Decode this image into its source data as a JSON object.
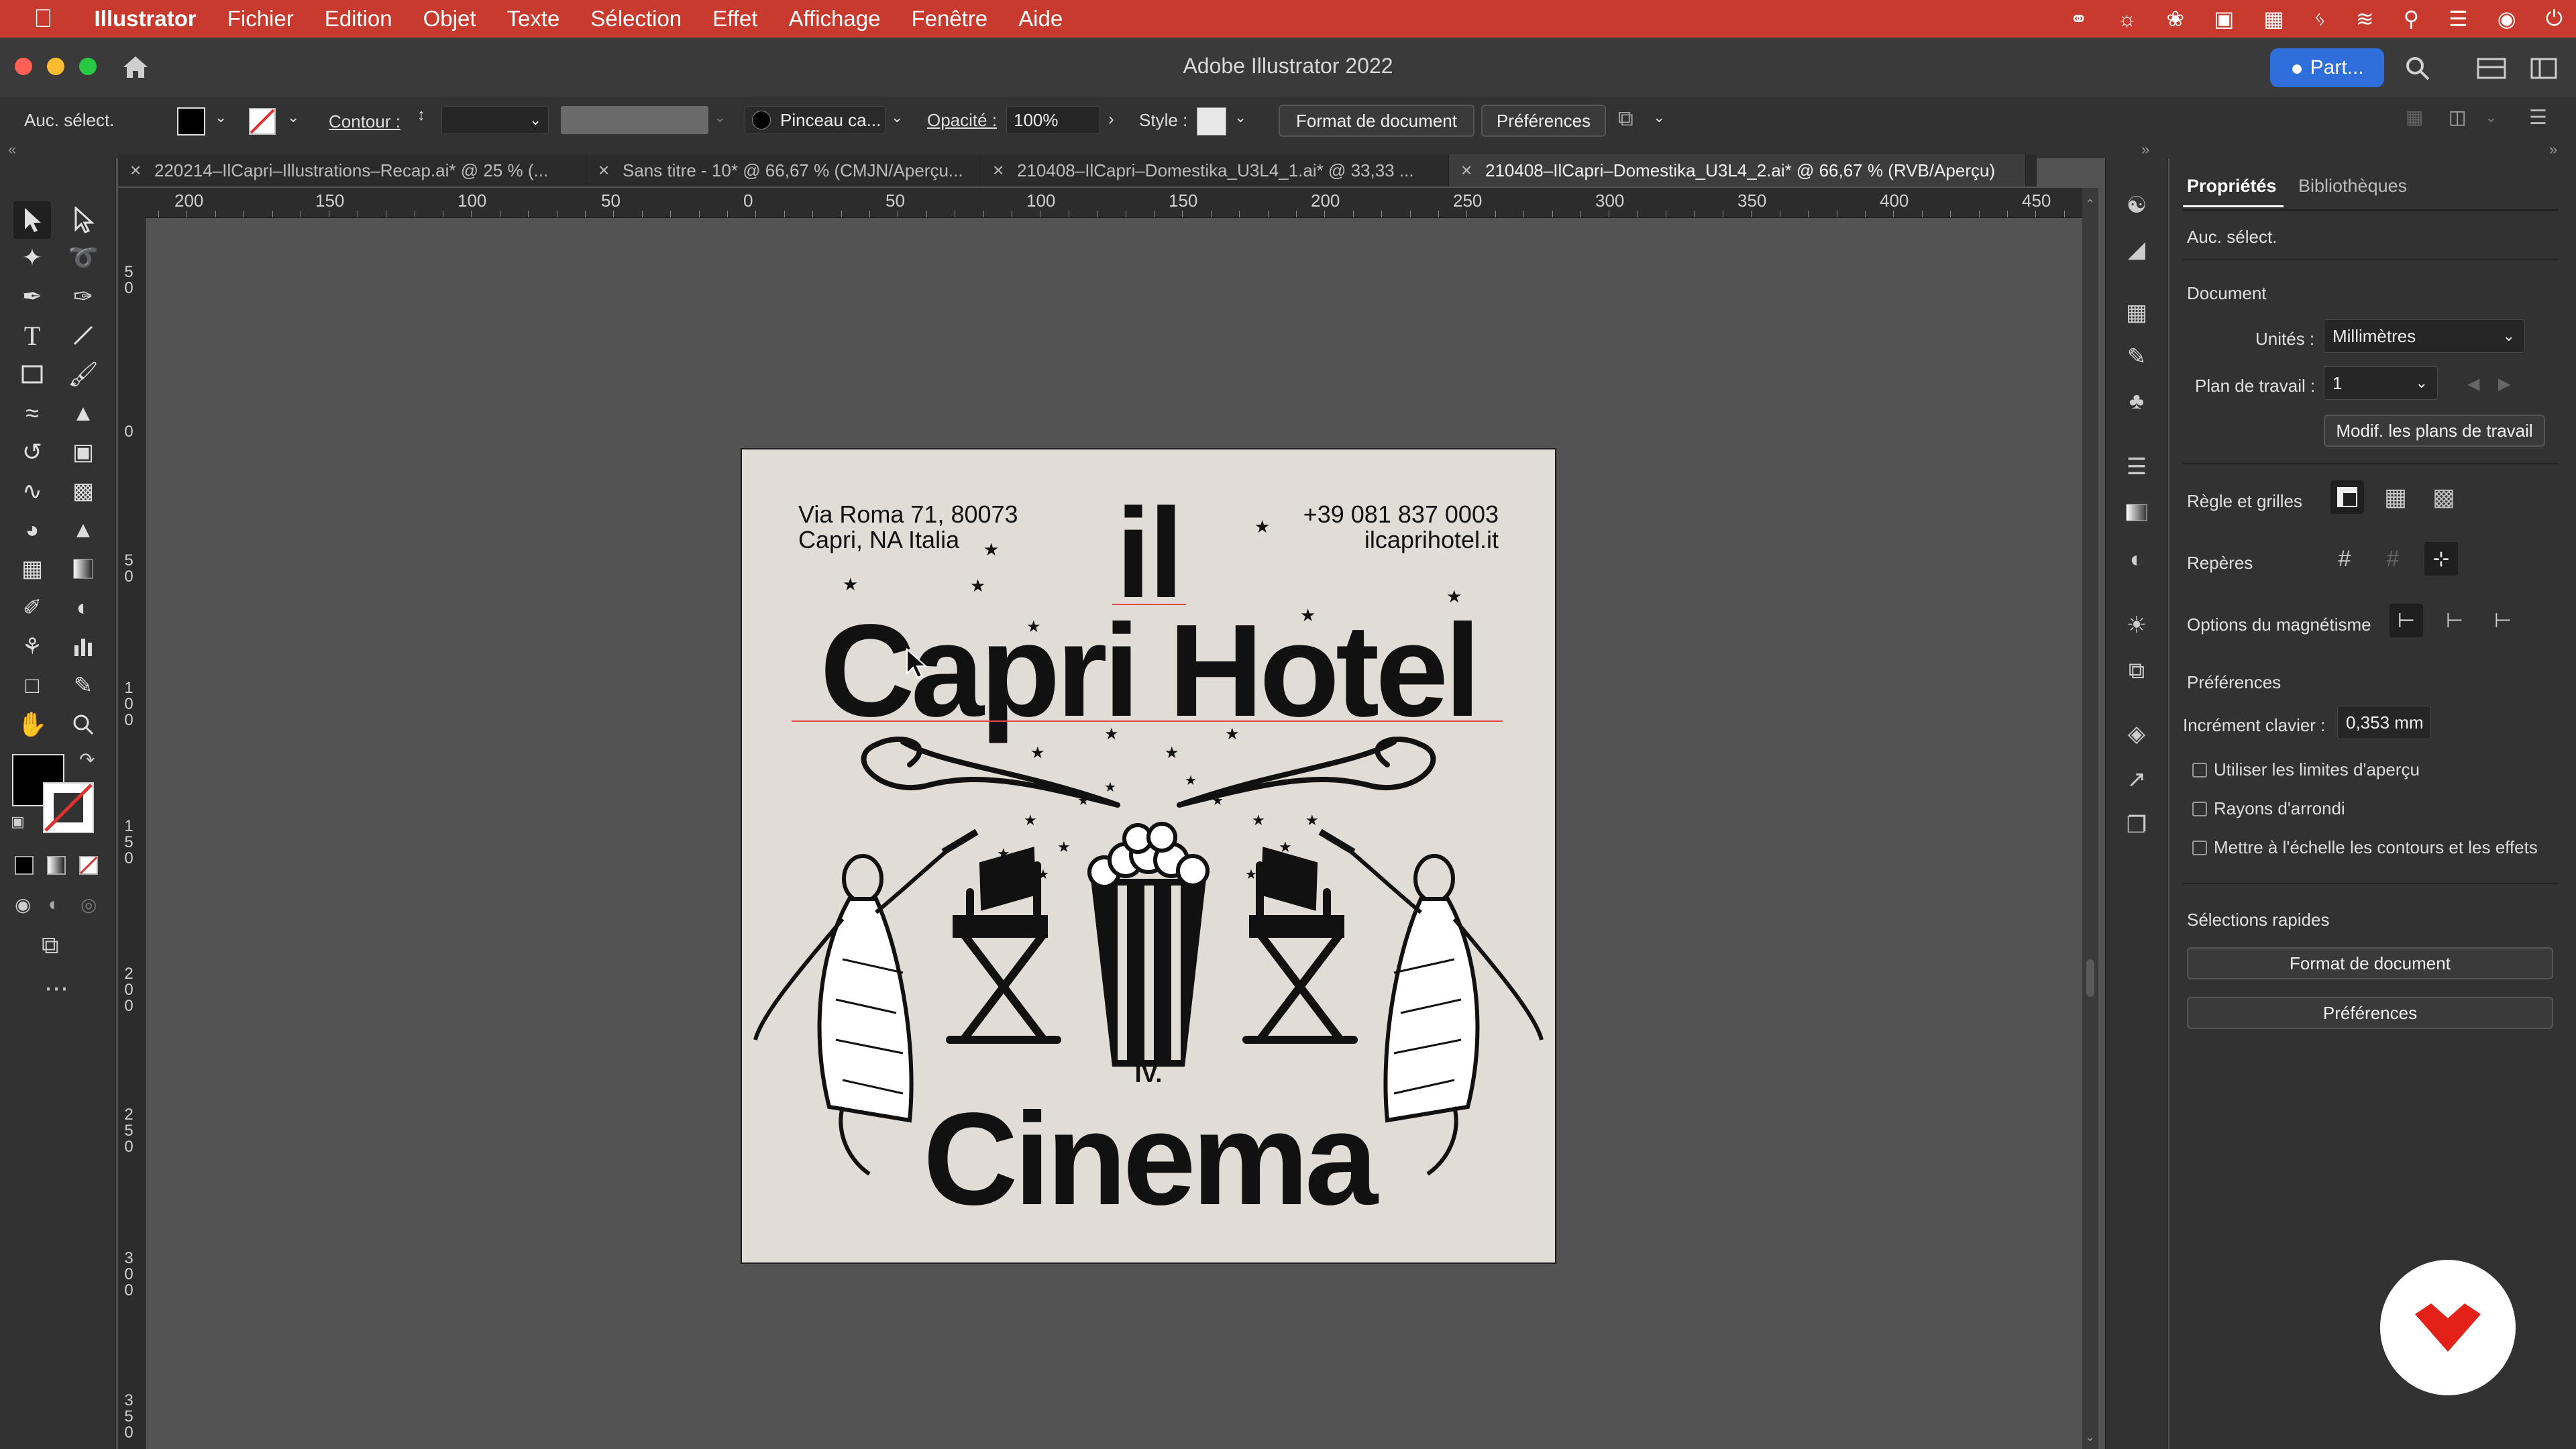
{
  "menubar": {
    "app": "Illustrator",
    "items": [
      "Fichier",
      "Edition",
      "Objet",
      "Texte",
      "Sélection",
      "Effet",
      "Affichage",
      "Fenêtre",
      "Aide"
    ]
  },
  "window": {
    "title": "Adobe Illustrator 2022",
    "share_label": "Part..."
  },
  "control_bar": {
    "selection": "Auc. sélect.",
    "stroke_label": "Contour :",
    "brush": "Pinceau ca...",
    "opacity_label": "Opacité :",
    "opacity_value": "100%",
    "style_label": "Style :",
    "doc_format_btn": "Format de document",
    "prefs_btn": "Préférences"
  },
  "tabs": [
    {
      "label": "220214–IlCapri–Illustrations–Recap.ai* @ 25 % (..."
    },
    {
      "label": "Sans titre - 10* @ 66,67 % (CMJN/Aperçu..."
    },
    {
      "label": "210408–IlCapri–Domestika_U3L4_1.ai* @ 33,33 ..."
    },
    {
      "label": "210408–IlCapri–Domestika_U3L4_2.ai* @ 66,67 % (RVB/Aperçu)"
    }
  ],
  "ruler": {
    "top": [
      "200",
      "150",
      "100",
      "50",
      "0",
      "50",
      "100",
      "150",
      "200",
      "250",
      "300",
      "350",
      "400",
      "450"
    ],
    "left": [
      [
        "5",
        "0"
      ],
      [
        "0"
      ],
      [
        "5",
        "0"
      ],
      [
        "1",
        "0",
        "0"
      ],
      [
        "1",
        "5",
        "0"
      ],
      [
        "2",
        "0",
        "0"
      ],
      [
        "2",
        "5",
        "0"
      ],
      [
        "3",
        "0",
        "0"
      ],
      [
        "3",
        "5",
        "0"
      ]
    ]
  },
  "artwork": {
    "address_line1": "Via Roma 71, 80073",
    "address_line2": "Capri, NA Italia",
    "phone": "+39 081 837 0003",
    "website": "ilcaprihotel.it",
    "title_small": "il",
    "title_main": "Capri Hotel",
    "numeral": "IV.",
    "subtitle": "Cinema"
  },
  "properties": {
    "tab_properties": "Propriétés",
    "tab_libraries": "Bibliothèques",
    "selection": "Auc. sélect.",
    "document_header": "Document",
    "units_label": "Unités :",
    "units_value": "Millimètres",
    "artboard_label": "Plan de travail :",
    "artboard_value": "1",
    "edit_artboards_btn": "Modif. les plans de travail",
    "rulers_grids": "Règle et grilles",
    "guides": "Repères",
    "snap_options": "Options du magnétisme",
    "preferences_header": "Préférences",
    "keyboard_increment_label": "Incrément clavier :",
    "keyboard_increment_value": "0,353 mm",
    "chk_preview_bounds": "Utiliser les limites d'aperçu",
    "chk_rounded_corners": "Rayons d'arrondi",
    "chk_scale_strokes": "Mettre à l'échelle les contours et les effets",
    "quick_actions": "Sélections rapides",
    "doc_format_btn": "Format de document",
    "prefs_btn": "Préférences"
  },
  "colors": {
    "menubar": "#c73a2d",
    "accent_blue": "#2f6fdc",
    "artboard_bg": "#e2dcd6",
    "domestika_red": "#e32119"
  }
}
